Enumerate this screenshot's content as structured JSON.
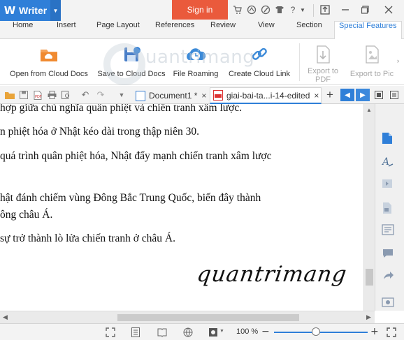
{
  "app": {
    "name": "Writer",
    "sign_in": "Sign in"
  },
  "tabs": [
    "Home",
    "Insert",
    "Page Layout",
    "References",
    "Review",
    "View",
    "Section",
    "Special Features"
  ],
  "active_tab": "Special Features",
  "ribbon": {
    "open_cloud": "Open from Cloud Docs",
    "save_cloud": "Save to Cloud Docs",
    "file_roaming": "File Roaming",
    "create_link": "Create Cloud Link",
    "export_pdf_1": "Export to",
    "export_pdf_2": "PDF",
    "export_pic": "Export to Pic"
  },
  "watermark": "uantrimang",
  "doc_tabs": {
    "tab1": "Document1 *",
    "tab2": "giai-bai-ta...i-14-edited"
  },
  "document": {
    "line1": "hợp giữa chủ nghĩa quân phiệt và chiến tranh xâm lược.",
    "line2": "n phiệt hóa ở Nhật kéo dài trong thập niên 30.",
    "line3": "quá trình quân phiệt hóa, Nhật đẩy mạnh chiến tranh xâm lược",
    "line4": "hật đánh chiếm vùng Đông Bắc Trung Quốc, biến đây thành",
    "line5": "ông châu Á.",
    "line6": "sự trở thành lò lửa chiến tranh ở châu Á.",
    "signature": "quantrimang"
  },
  "status": {
    "zoom": "100 %",
    "zoom_level": 0.45
  },
  "colors": {
    "accent": "#2f7fd8",
    "sign_in": "#ea5a3c"
  }
}
